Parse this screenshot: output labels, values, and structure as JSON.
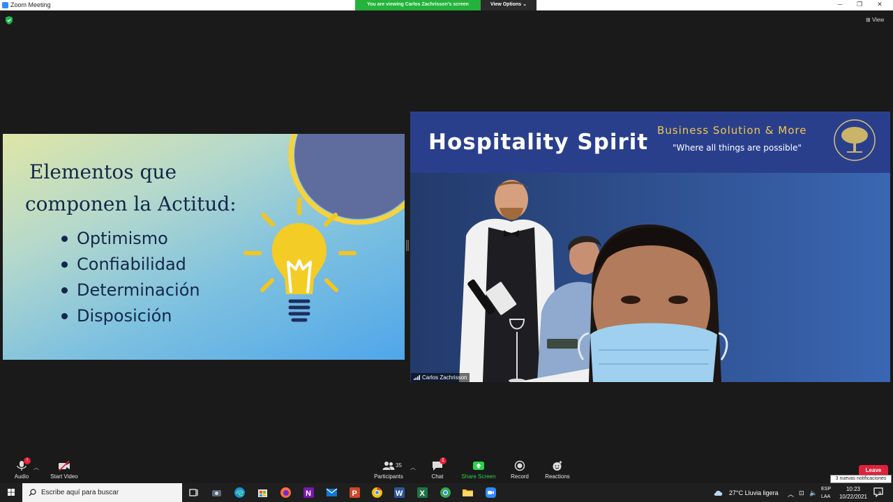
{
  "window": {
    "title": "Zoom Meeting",
    "share_banner": "You are viewing Carlos Zachrisson's screen",
    "view_options": "View Options",
    "view_label": "View",
    "buttons": {
      "minimize": "─",
      "maximize": "❐",
      "close": "✕"
    }
  },
  "slide": {
    "title_line1": "Elementos que",
    "title_line2": "componen la Actitud:",
    "items": [
      "Optimismo",
      "Confiabilidad",
      "Determinación",
      "Disposición"
    ]
  },
  "video": {
    "brand_name": "Hospitality Spirit",
    "brand_tagline": "Business Solution & More",
    "brand_quote": "\"Where all things are possible\"",
    "participant_name": "Carlos Zachrisson"
  },
  "controls": {
    "audio": {
      "label": "Audio",
      "badge": "!"
    },
    "video": {
      "label": "Start Video"
    },
    "participants": {
      "label": "Participants",
      "count": "35"
    },
    "chat": {
      "label": "Chat",
      "badge": "1"
    },
    "share": {
      "label": "Share Screen"
    },
    "record": {
      "label": "Record"
    },
    "reactions": {
      "label": "Reactions"
    },
    "leave": "Leave",
    "notification": "3 nuevas notificaciones"
  },
  "taskbar": {
    "search_placeholder": "Escribe aquí para buscar",
    "weather": "27°C  Lluvia ligera",
    "lang_line1": "ESP",
    "lang_line2": "LAA",
    "time": "10:23",
    "date": "10/22/2021",
    "notif_count": "3"
  },
  "colors": {
    "zoom_blue": "#2d8cff",
    "share_green": "#24b23b",
    "leave_red": "#e0223b",
    "slide_text": "#14284a",
    "brand_gold": "#f2c94c"
  }
}
